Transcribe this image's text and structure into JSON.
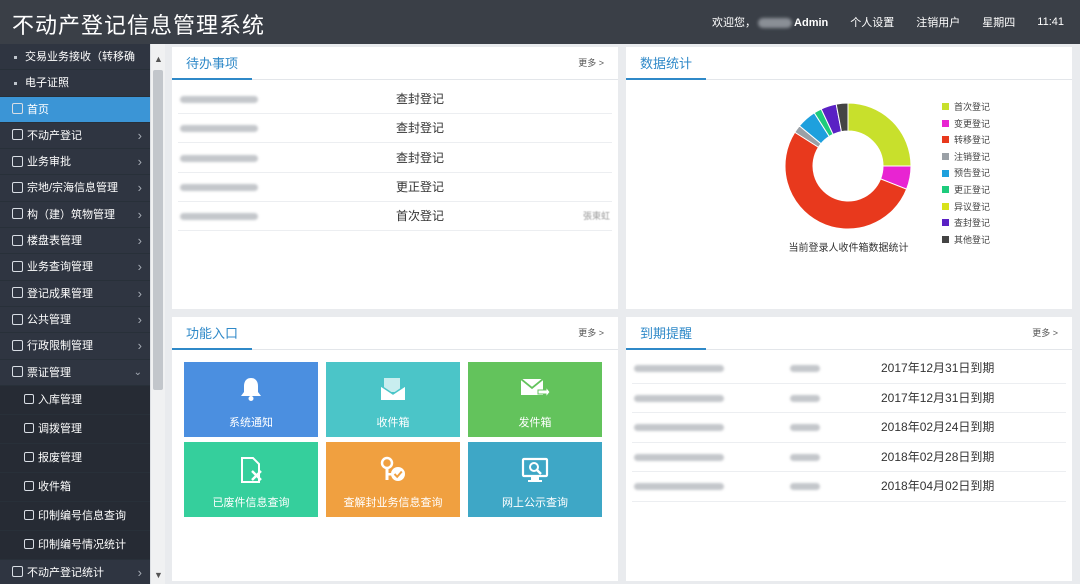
{
  "header": {
    "app_title": "不动产登记信息管理系统",
    "welcome": "欢迎您，",
    "admin": "Admin",
    "personal_settings": "个人设置",
    "logout": "注销用户",
    "weekday": "星期四",
    "time": "11:41"
  },
  "sidebar": {
    "items": [
      {
        "label": "交易业务接收（转移确",
        "kind": "sub"
      },
      {
        "label": "电子证照",
        "kind": "sub"
      },
      {
        "label": "首页",
        "kind": "active"
      },
      {
        "label": "不动产登记",
        "kind": "menu"
      },
      {
        "label": "业务审批",
        "kind": "menu"
      },
      {
        "label": "宗地/宗海信息管理",
        "kind": "menu"
      },
      {
        "label": "构（建）筑物管理",
        "kind": "menu"
      },
      {
        "label": "楼盘表管理",
        "kind": "menu"
      },
      {
        "label": "业务查询管理",
        "kind": "menu"
      },
      {
        "label": "登记成果管理",
        "kind": "menu"
      },
      {
        "label": "公共管理",
        "kind": "menu"
      },
      {
        "label": "行政限制管理",
        "kind": "menu"
      },
      {
        "label": "票证管理",
        "kind": "open"
      },
      {
        "label": "入库管理",
        "kind": "sub2"
      },
      {
        "label": "调拨管理",
        "kind": "sub2"
      },
      {
        "label": "报废管理",
        "kind": "sub2"
      },
      {
        "label": "收件箱",
        "kind": "sub2"
      },
      {
        "label": "印制编号信息查询",
        "kind": "sub2"
      },
      {
        "label": "印制编号情况统计",
        "kind": "sub2"
      },
      {
        "label": "不动产登记统计",
        "kind": "menu"
      }
    ]
  },
  "todo": {
    "title": "待办事项",
    "more": "更多 >",
    "rows": [
      {
        "type": "查封登记",
        "extra": ""
      },
      {
        "type": "查封登记",
        "extra": ""
      },
      {
        "type": "查封登记",
        "extra": ""
      },
      {
        "type": "更正登记",
        "extra": ""
      },
      {
        "type": "首次登记",
        "extra": "張東虹"
      }
    ]
  },
  "stats": {
    "title": "数据统计",
    "caption": "当前登录人收件箱数据统计"
  },
  "chart_data": {
    "type": "pie",
    "title": "当前登录人收件箱数据统计",
    "categories": [
      "首次登记",
      "变更登记",
      "转移登记",
      "注销登记",
      "预告登记",
      "更正登记",
      "异议登记",
      "查封登记",
      "其他登记"
    ],
    "values": [
      25,
      6,
      53,
      2,
      5,
      2,
      0,
      4,
      3
    ],
    "colors": [
      "#c8e02c",
      "#e824d2",
      "#e8391d",
      "#9aa0a6",
      "#1ea0dd",
      "#1ecb7c",
      "#d8e21a",
      "#5a21c4",
      "#444444"
    ],
    "legend": "right"
  },
  "func": {
    "title": "功能入口",
    "more": "更多 >",
    "tiles": [
      {
        "label": "系统通知",
        "color": "#4b8fe0",
        "icon": "bell-icon"
      },
      {
        "label": "收件箱",
        "color": "#4bc5c8",
        "icon": "inbox-icon"
      },
      {
        "label": "发件箱",
        "color": "#63c35c",
        "icon": "outbox-icon"
      },
      {
        "label": "已废件信息查询",
        "color": "#35cf9c",
        "icon": "void-file-icon"
      },
      {
        "label": "查解封业务信息查询",
        "color": "#f0a040",
        "icon": "key-check-icon"
      },
      {
        "label": "网上公示查询",
        "color": "#3ea7c6",
        "icon": "monitor-search-icon"
      }
    ]
  },
  "expire": {
    "title": "到期提醒",
    "more": "更多 >",
    "rows": [
      {
        "date": "2017年12月31日到期"
      },
      {
        "date": "2017年12月31日到期"
      },
      {
        "date": "2018年02月24日到期"
      },
      {
        "date": "2018年02月28日到期"
      },
      {
        "date": "2018年04月02日到期"
      }
    ]
  }
}
